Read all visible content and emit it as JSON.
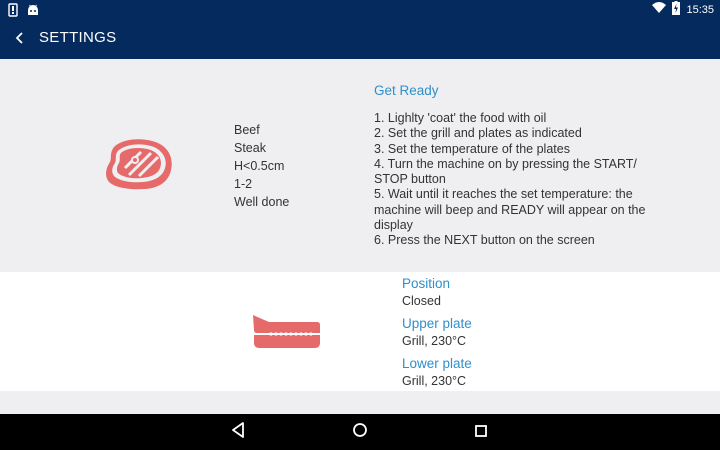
{
  "status_bar": {
    "time": "15:35",
    "icons": [
      "notification-icon",
      "android-icon",
      "wifi-icon",
      "battery-charging-icon"
    ]
  },
  "app_bar": {
    "title": "SETTINGS",
    "back_icon": "back-chevron-icon"
  },
  "food": {
    "icon": "steak-icon",
    "details": [
      "Beef",
      "Steak",
      "H<0.5cm",
      "1-2",
      "Well done"
    ]
  },
  "instructions": {
    "title": "Get Ready",
    "steps": [
      "1. Lighlty 'coat' the food with oil",
      "2. Set the grill and plates as indicated",
      "3. Set the temperature of the plates",
      "4. Turn the machine on by pressing the START/",
      "STOP button",
      "5. Wait until it reaches the set temperature: the",
      "machine will beep and READY will appear on the",
      "display",
      "6. Press the NEXT button on the screen"
    ]
  },
  "grill_settings": {
    "icon": "closed-grill-plates-icon",
    "items": [
      {
        "label": "Position",
        "value": "Closed"
      },
      {
        "label": "Upper plate",
        "value": "Grill, 230°C"
      },
      {
        "label": "Lower plate",
        "value": "Grill, 230°C"
      }
    ]
  },
  "nav_bar": {
    "icons": [
      "back-triangle-icon",
      "home-circle-icon",
      "recents-square-icon"
    ]
  },
  "colors": {
    "primary_dark": "#052a5e",
    "accent_blue": "#2f8fcb",
    "icon_red": "#e66a6a",
    "panel_gray": "#efeff1"
  }
}
